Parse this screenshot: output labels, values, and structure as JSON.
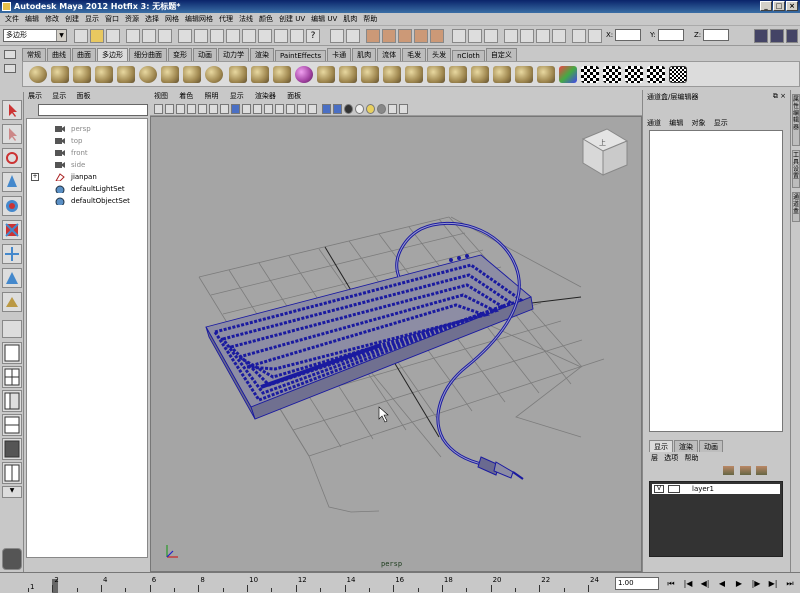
{
  "window": {
    "title": "Autodesk Maya 2012 Hotfix 3: 无标题*"
  },
  "menubar": [
    "文件",
    "编辑",
    "修改",
    "创建",
    "显示",
    "窗口",
    "资源",
    "选择",
    "网格",
    "编辑网格",
    "代理",
    "法线",
    "颜色",
    "创建 UV",
    "编辑 UV",
    "肌肉",
    "帮助"
  ],
  "statusline": {
    "mode": "多边形",
    "x_label": "X:",
    "y_label": "Y:",
    "z_label": "Z:"
  },
  "shelf": {
    "tabs": [
      "常规",
      "曲线",
      "曲面",
      "多边形",
      "细分曲面",
      "变形",
      "动画",
      "动力学",
      "渲染",
      "PaintEffects",
      "卡通",
      "肌肉",
      "流体",
      "毛发",
      "头发",
      "nCloth",
      "自定义"
    ],
    "active_tab": "多边形"
  },
  "outliner": {
    "menu": [
      "展示",
      "显示",
      "面板"
    ],
    "items": [
      {
        "label": "persp",
        "icon": "camera-icon",
        "dim": true
      },
      {
        "label": "top",
        "icon": "camera-icon",
        "dim": true
      },
      {
        "label": "front",
        "icon": "camera-icon",
        "dim": true
      },
      {
        "label": "side",
        "icon": "camera-icon",
        "dim": true
      },
      {
        "label": "jianpan",
        "icon": "mesh-icon",
        "dim": false
      },
      {
        "label": "defaultLightSet",
        "icon": "set-icon",
        "dim": false
      },
      {
        "label": "defaultObjectSet",
        "icon": "set-icon",
        "dim": false
      }
    ],
    "expand_symbol": "+"
  },
  "viewport": {
    "menu": [
      "视图",
      "着色",
      "照明",
      "显示",
      "渲染器",
      "面板"
    ],
    "camera_label": "persp",
    "viewcube_label": "上"
  },
  "channelbox": {
    "title": "通道盒/层编辑器",
    "menu": [
      "通道",
      "编辑",
      "对象",
      "显示"
    ],
    "layer_tabs": [
      "显示",
      "渲染",
      "动画"
    ],
    "layer_menu": [
      "层",
      "选项",
      "帮助"
    ],
    "layer": {
      "visible": "V",
      "name": "layer1"
    }
  },
  "sidestrip": [
    "属性编辑器",
    "工具设置",
    "通道盒"
  ],
  "timeline": {
    "ticks": [
      "1",
      "2",
      "4",
      "6",
      "8",
      "10",
      "12",
      "14",
      "16",
      "18",
      "20",
      "22",
      "24"
    ],
    "current_frame": "1.00"
  },
  "colors": {
    "viewport_bg": "#a5a5a5",
    "wire": "#1a1aa0",
    "title_bar": "#0a246a"
  }
}
